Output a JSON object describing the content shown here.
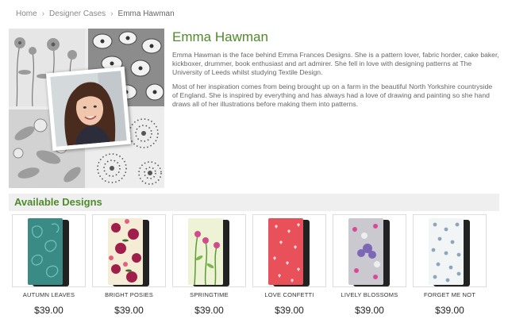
{
  "breadcrumb": {
    "home": "Home",
    "designer_cases": "Designer Cases",
    "current": "Emma Hawman"
  },
  "profile": {
    "name": "Emma Hawman",
    "bio_paragraphs": [
      "Emma Hawman is the face behind Emma Frances Designs. She is a pattern lover, fabric horder, cake baker, kickboxer, drummer, book enthusiast and art admirer. She fell in love with designing patterns at The University of Leeds whilst studying Textile Design.",
      "Most of her inspiration comes from being brought up on a farm in the beautiful North Yorkshire countryside of England. She is inspired by everything and has always had a love of drawing and painting so she hand draws all of her illustrations before making them into patterns."
    ]
  },
  "designs_section": {
    "title": "Available Designs"
  },
  "products": [
    {
      "name": "AUTUMN LEAVES",
      "price": "$39.00",
      "color": "#3a8a86"
    },
    {
      "name": "BRIGHT POSIES",
      "price": "$39.00",
      "color": "#f5ecd6"
    },
    {
      "name": "SPRINGTIME",
      "price": "$39.00",
      "color": "#eef3d6"
    },
    {
      "name": "LOVE CONFETTI",
      "price": "$39.00",
      "color": "#e8505a"
    },
    {
      "name": "LIVELY BLOSSOMS",
      "price": "$39.00",
      "color": "#c9c9cf"
    },
    {
      "name": "FORGET ME NOT",
      "price": "$39.00",
      "color": "#f2f5f6"
    }
  ],
  "colors": {
    "accent_green": "#4f8a2b"
  }
}
